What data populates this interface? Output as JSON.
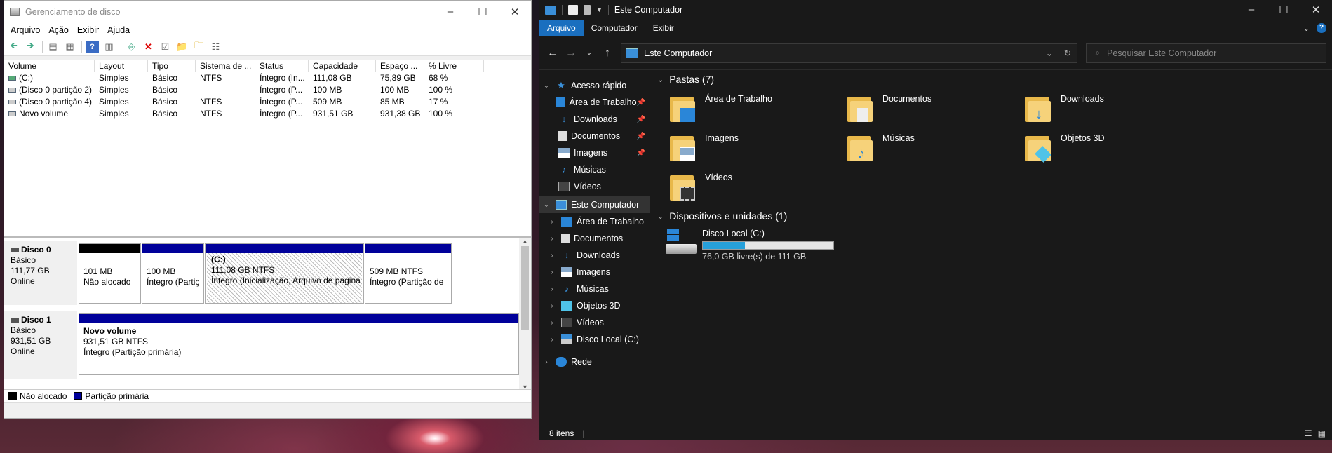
{
  "disk_mgmt": {
    "title": "Gerenciamento de disco",
    "menu": [
      "Arquivo",
      "Ação",
      "Exibir",
      "Ajuda"
    ],
    "columns": [
      "Volume",
      "Layout",
      "Tipo",
      "Sistema de ...",
      "Status",
      "Capacidade",
      "Espaço ...",
      "% Livre"
    ],
    "rows": [
      [
        "(C:)",
        "Simples",
        "Básico",
        "NTFS",
        "Íntegro (In...",
        "111,08 GB",
        "75,89 GB",
        "68 %"
      ],
      [
        "(Disco 0 partição 2)",
        "Simples",
        "Básico",
        "",
        "Íntegro (P...",
        "100 MB",
        "100 MB",
        "100 %"
      ],
      [
        "(Disco 0 partição 4)",
        "Simples",
        "Básico",
        "NTFS",
        "Íntegro (P...",
        "509 MB",
        "85 MB",
        "17 %"
      ],
      [
        "Novo volume",
        "Simples",
        "Básico",
        "NTFS",
        "Íntegro (P...",
        "931,51 GB",
        "931,38 GB",
        "100 %"
      ]
    ],
    "disks": [
      {
        "name": "Disco 0",
        "type": "Básico",
        "size": "111,77 GB",
        "state": "Online",
        "partitions": [
          {
            "line1": "",
            "line2": "101 MB",
            "line3": "Não alocado"
          },
          {
            "line1": "",
            "line2": "100 MB",
            "line3": "Íntegro (Partiç"
          },
          {
            "line1": "(C:)",
            "line2": "111,08 GB NTFS",
            "line3": "Íntegro (Inicialização, Arquivo de pagina"
          },
          {
            "line1": "",
            "line2": "509 MB NTFS",
            "line3": "Íntegro (Partição de"
          }
        ]
      },
      {
        "name": "Disco 1",
        "type": "Básico",
        "size": "931,51 GB",
        "state": "Online",
        "partitions": [
          {
            "line1": "Novo volume",
            "line2": "931,51 GB NTFS",
            "line3": "Íntegro (Partição primária)"
          }
        ]
      }
    ],
    "legend": [
      "Não alocado",
      "Partição primária"
    ],
    "colors": {
      "unallocated": "#000000",
      "primary": "#00009a"
    }
  },
  "explorer": {
    "title": "Este Computador",
    "ribbon_tabs": [
      "Arquivo",
      "Computador",
      "Exibir"
    ],
    "address": "Este Computador",
    "search_placeholder": "Pesquisar Este Computador",
    "sidebar": {
      "quick_access": "Acesso rápido",
      "quick_items": [
        "Área de Trabalho",
        "Downloads",
        "Documentos",
        "Imagens",
        "Músicas",
        "Vídeos"
      ],
      "this_pc": "Este Computador",
      "pc_items": [
        "Área de Trabalho",
        "Documentos",
        "Downloads",
        "Imagens",
        "Músicas",
        "Objetos 3D",
        "Vídeos",
        "Disco Local (C:)"
      ],
      "network": "Rede"
    },
    "folders_header": "Pastas (7)",
    "folders": [
      "Área de Trabalho",
      "Documentos",
      "Downloads",
      "Imagens",
      "Músicas",
      "Objetos 3D",
      "Vídeos"
    ],
    "devices_header": "Dispositivos e unidades (1)",
    "drive": {
      "name": "Disco Local (C:)",
      "free_text": "76,0 GB livre(s) de 111 GB",
      "used_fraction": 0.32
    },
    "status": "8 itens",
    "colors": {
      "accent": "#1a6fbf",
      "drive_bar": "#26a0da"
    }
  }
}
